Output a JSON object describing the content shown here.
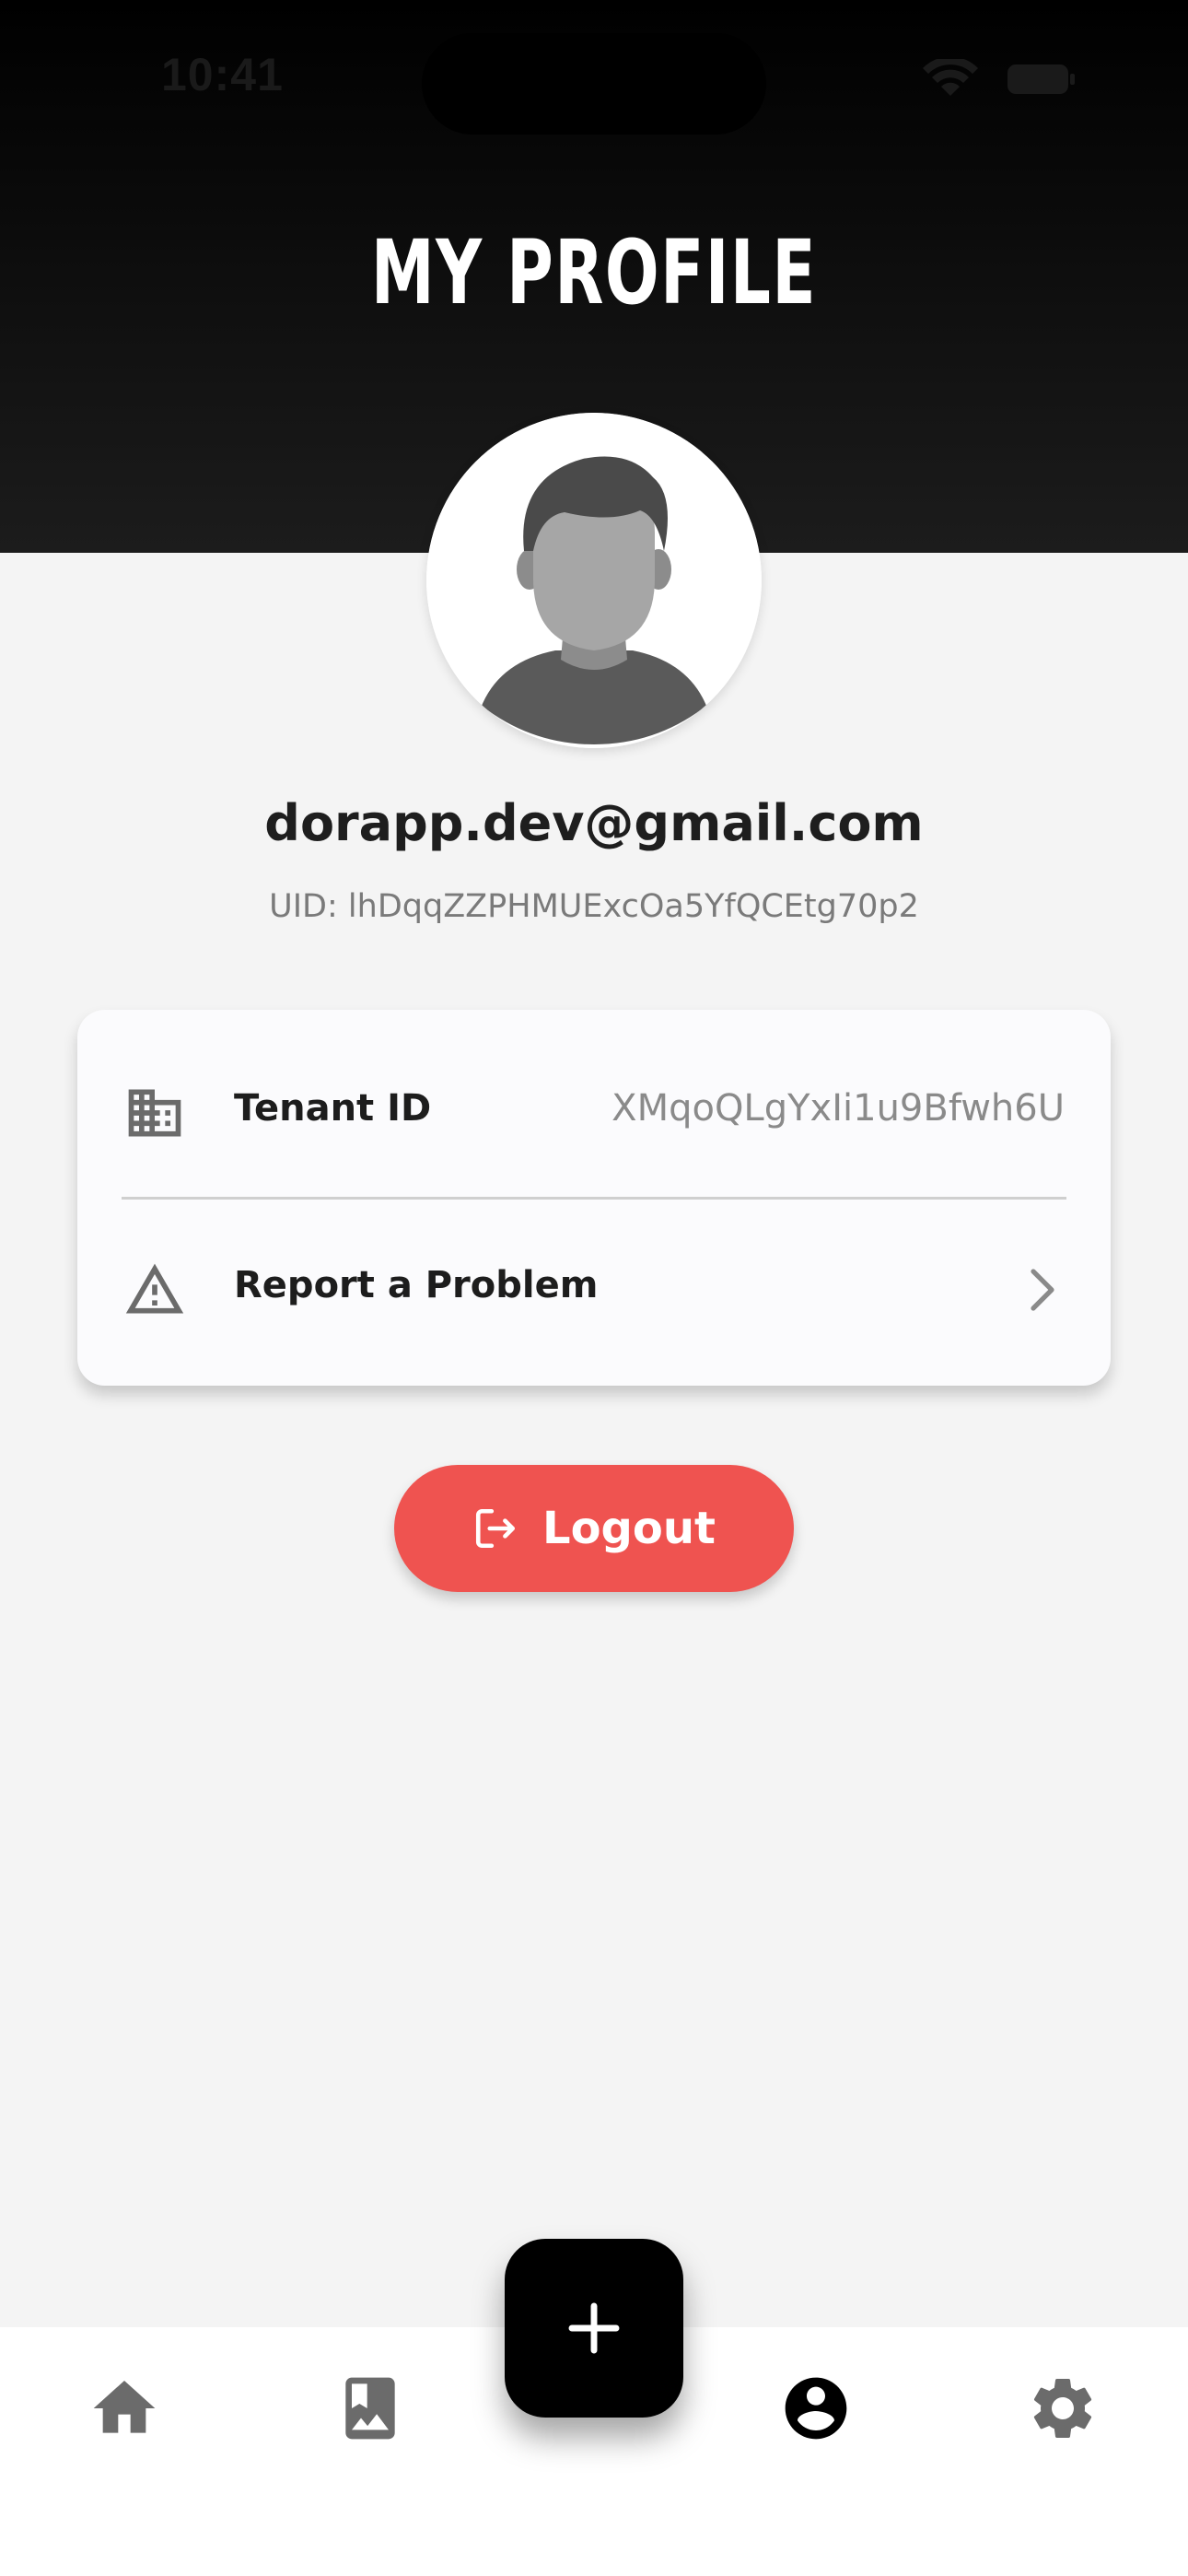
{
  "status_bar": {
    "time": "10:41"
  },
  "header": {
    "title": "MY PROFILE"
  },
  "profile": {
    "email": "dorapp.dev@gmail.com",
    "uid": "UID: lhDqqZZPHMUExcOa5YfQCEtg70p2"
  },
  "card": {
    "tenant": {
      "icon": "building-icon",
      "label": "Tenant ID",
      "value": "XMqoQLgYxIi1u9Bfwh6U"
    },
    "report": {
      "icon": "warning-icon",
      "label": "Report a Problem",
      "trailing_icon": "chevron-right-icon"
    }
  },
  "logout": {
    "label": "Logout",
    "icon": "logout-icon",
    "color": "#EF5350"
  },
  "bottom_nav": {
    "items": [
      {
        "icon": "home-icon",
        "active": false
      },
      {
        "icon": "photo-album-icon",
        "active": false
      },
      {
        "icon": "account-circle-icon",
        "active": true
      },
      {
        "icon": "settings-gear-icon",
        "active": false
      }
    ],
    "fab_icon": "plus-icon",
    "active_color": "#000000",
    "inactive_color": "#6B6B6B"
  }
}
